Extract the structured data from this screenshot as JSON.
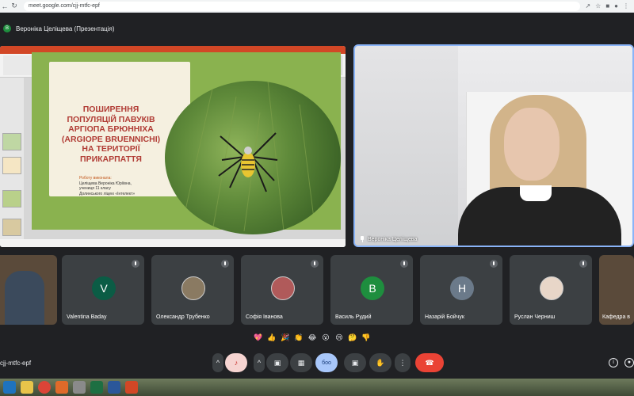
{
  "browser": {
    "url": "meet.google.com/cjj-mtfc-epf"
  },
  "meeting": {
    "presenter_label": "Вероніка Целіщева (Презентація)",
    "presenter_initial": "В",
    "meeting_code": "cjj-mtfc-epf"
  },
  "slide": {
    "title_lines": [
      "ПОШИРЕННЯ",
      "ПОПУЛЯЦІЙ ПАВУКІВ",
      "АРГІОПА БРЮННІХА",
      "(ARGIOPE BRUENNICHI)",
      "НА ТЕРИТОРІЇ",
      "ПРИКАРПАТТЯ"
    ],
    "author_label": "Роботу виконала:",
    "author_lines": [
      "Целіщева Вероніка Юріївна,",
      "учениця 11 класу",
      "Долинського ліцею «Інтелект»"
    ]
  },
  "speaker": {
    "name": "Вероніка Целіщева"
  },
  "participants": [
    {
      "name": "",
      "initial": "",
      "color": "",
      "type": "video"
    },
    {
      "name": "Valentina Baday",
      "initial": "V",
      "color": "#0b5c45",
      "type": "letter"
    },
    {
      "name": "Олександр Трубенко",
      "initial": "",
      "color": "#8a7a62",
      "type": "photo"
    },
    {
      "name": "Софія Іванова",
      "initial": "",
      "color": "#b05a5a",
      "type": "photo"
    },
    {
      "name": "Василь Рудий",
      "initial": "B",
      "color": "#1e8e3e",
      "type": "letter"
    },
    {
      "name": "Назарій Бойчук",
      "initial": "H",
      "color": "#6b7a8a",
      "type": "letter"
    },
    {
      "name": "Руслан Черниш",
      "initial": "",
      "color": "#e8d6c8",
      "type": "photo"
    },
    {
      "name": "Кафедра в",
      "initial": "",
      "color": "",
      "type": "video"
    }
  ],
  "reactions": [
    "💖",
    "👍",
    "🎉",
    "👏",
    "😂",
    "😮",
    "😢",
    "🤔",
    "👎"
  ],
  "controls": {
    "present_label": "боо"
  },
  "colors": {
    "accent": "#8ab4f8",
    "end_call": "#ea4335",
    "background": "#202124"
  }
}
